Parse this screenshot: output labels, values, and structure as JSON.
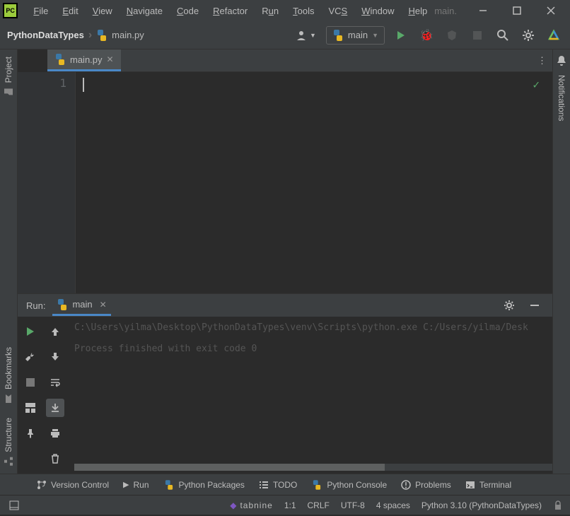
{
  "app": {
    "icon_text": "PC",
    "window_title": "main."
  },
  "menu": {
    "file": "File",
    "edit": "Edit",
    "view": "View",
    "navigate": "Navigate",
    "code": "Code",
    "refactor": "Refactor",
    "run": "Run",
    "tools": "Tools",
    "vcs": "VCS",
    "window": "Window",
    "help": "Help"
  },
  "breadcrumb": {
    "project": "PythonDataTypes",
    "file": "main.py"
  },
  "toolbar": {
    "run_config": "main"
  },
  "tabs": {
    "active": "main.py"
  },
  "editor": {
    "line_number": "1"
  },
  "left_tools": {
    "project": "Project",
    "bookmarks": "Bookmarks",
    "structure": "Structure"
  },
  "right_tools": {
    "notifications": "Notifications"
  },
  "run_panel": {
    "label": "Run:",
    "tab": "main",
    "output_line1": "C:\\Users\\yilma\\Desktop\\PythonDataTypes\\venv\\Scripts\\python.exe C:/Users/yilma/Desk",
    "output_line2": "",
    "output_line3": "Process finished with exit code 0"
  },
  "bottom": {
    "vcs": "Version Control",
    "run": "Run",
    "packages": "Python Packages",
    "todo": "TODO",
    "console": "Python Console",
    "problems": "Problems",
    "terminal": "Terminal"
  },
  "status": {
    "tabnine": "tabnine",
    "pos": "1:1",
    "line_sep": "CRLF",
    "encoding": "UTF-8",
    "indent": "4 spaces",
    "interpreter": "Python 3.10 (PythonDataTypes)"
  }
}
